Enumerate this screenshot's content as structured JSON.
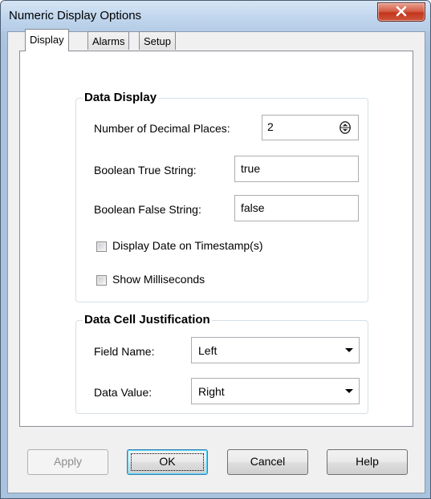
{
  "window": {
    "title": "Numeric Display Options",
    "close_symbol": "X"
  },
  "tabs": [
    {
      "label": "Display",
      "active": true
    },
    {
      "label": "Alarms",
      "active": false
    },
    {
      "label": "Setup",
      "active": false
    }
  ],
  "data_display": {
    "group_title": "Data Display",
    "decimal_places_label": "Number of Decimal Places:",
    "decimal_places_value": "2",
    "true_string_label": "Boolean True String:",
    "true_string_value": "true",
    "false_string_label": "Boolean False String:",
    "false_string_value": "false",
    "display_date_label": "Display Date on Timestamp(s)",
    "display_date_checked": false,
    "show_ms_label": "Show Milliseconds",
    "show_ms_checked": false
  },
  "justification": {
    "group_title": "Data Cell Justification",
    "field_name_label": "Field Name:",
    "field_name_value": "Left",
    "data_value_label": "Data Value:",
    "data_value_value": "Right"
  },
  "buttons": {
    "apply": "Apply",
    "ok": "OK",
    "cancel": "Cancel",
    "help": "Help"
  },
  "icons": {
    "close": "close-icon",
    "spinner": "spinner-icon",
    "dropdown": "chevron-down-icon"
  }
}
